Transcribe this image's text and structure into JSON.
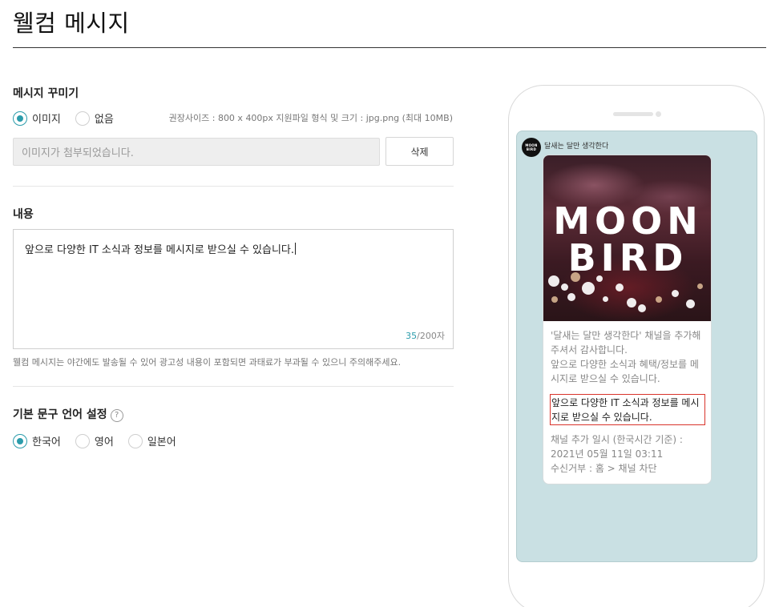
{
  "page": {
    "title": "웰컴 메시지"
  },
  "decoration": {
    "label": "메시지 꾸미기",
    "options": [
      {
        "label": "이미지",
        "checked": true
      },
      {
        "label": "없음",
        "checked": false
      }
    ],
    "size_hint": "권장사이즈 : 800 x 400px 지원파일 형식 및 크기 : jpg.png (최대 10MB)",
    "file_field_text": "이미지가 첨부되었습니다.",
    "delete_button": "삭제"
  },
  "content": {
    "label": "내용",
    "text": "앞으로 다양한 IT 소식과 정보를 메시지로 받으실 수 있습니다.",
    "count_current": "35",
    "count_max": "/200자",
    "warning": "웰컴 메시지는 야간에도 발송될 수 있어 광고성 내용이 포함되면 과태료가 부과될 수 있으니 주의해주세요."
  },
  "language": {
    "label": "기본 문구 언어 설정",
    "help": "?",
    "options": [
      {
        "label": "한국어",
        "checked": true
      },
      {
        "label": "영어",
        "checked": false
      },
      {
        "label": "일본어",
        "checked": false
      }
    ]
  },
  "preview": {
    "channel_name": "달새는 달만 생각한다",
    "avatar_text_1": "MOON",
    "avatar_text_2": "BIRD",
    "image_line_1": "MOON",
    "image_line_2": "BIRD",
    "intro_lines": [
      "'달새는 달만 생각한다' 채널을 추가해",
      "주셔서 감사합니다.",
      "앞으로 다양한 소식과 혜택/정보를 메",
      "시지로 받으실 수 있습니다."
    ],
    "custom_lines": [
      "앞으로 다양한 IT 소식과 정보를 메시",
      "지로 받으실 수 있습니다."
    ],
    "footer_lines": [
      "채널 추가 일시 (한국시간 기준) :",
      "2021년 05월 11일 03:11",
      "수신거부 : 홈 > 채널 차단"
    ]
  },
  "colors": {
    "accent": "#2b9cab",
    "highlight_border": "#d9342b",
    "preview_bg": "#c9e0e3"
  }
}
